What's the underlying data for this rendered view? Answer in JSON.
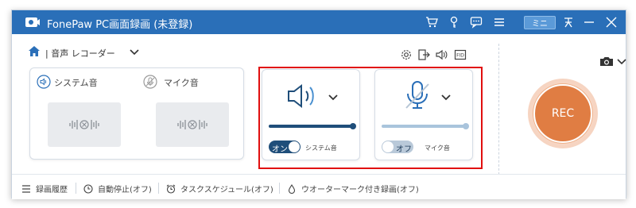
{
  "app": {
    "title": "FonePaw PC画面録画 (未登録)",
    "mini_label": "ミニ"
  },
  "titlebar_icons": [
    "cart-icon",
    "key-icon",
    "chat-icon",
    "menu-icon",
    "pin-icon",
    "minimize-icon",
    "close-icon"
  ],
  "toolbar": {
    "breadcrumb": "| 音声 レコーダー"
  },
  "sources": {
    "system": {
      "label": "システム音"
    },
    "mic": {
      "label": "マイク音"
    }
  },
  "big_cards": {
    "system": {
      "toggle_label": "オン",
      "toggle_on": true,
      "caption": "システム音",
      "volume": 1.0
    },
    "mic": {
      "toggle_label": "オフ",
      "toggle_on": false,
      "caption": "マイク音",
      "volume": 1.0
    }
  },
  "rec": {
    "label": "REC"
  },
  "bottom": {
    "history": "録画履歴",
    "auto_stop": "自動停止(オフ)",
    "schedule": "タスクスケジュール(オフ)",
    "watermark": "ウオーターマーク付き録画(オフ)"
  },
  "colors": {
    "titlebar": "#2a6fb8",
    "accent": "#1f4e7a",
    "rec": "#e07d43",
    "highlight": "#e10f0f"
  }
}
